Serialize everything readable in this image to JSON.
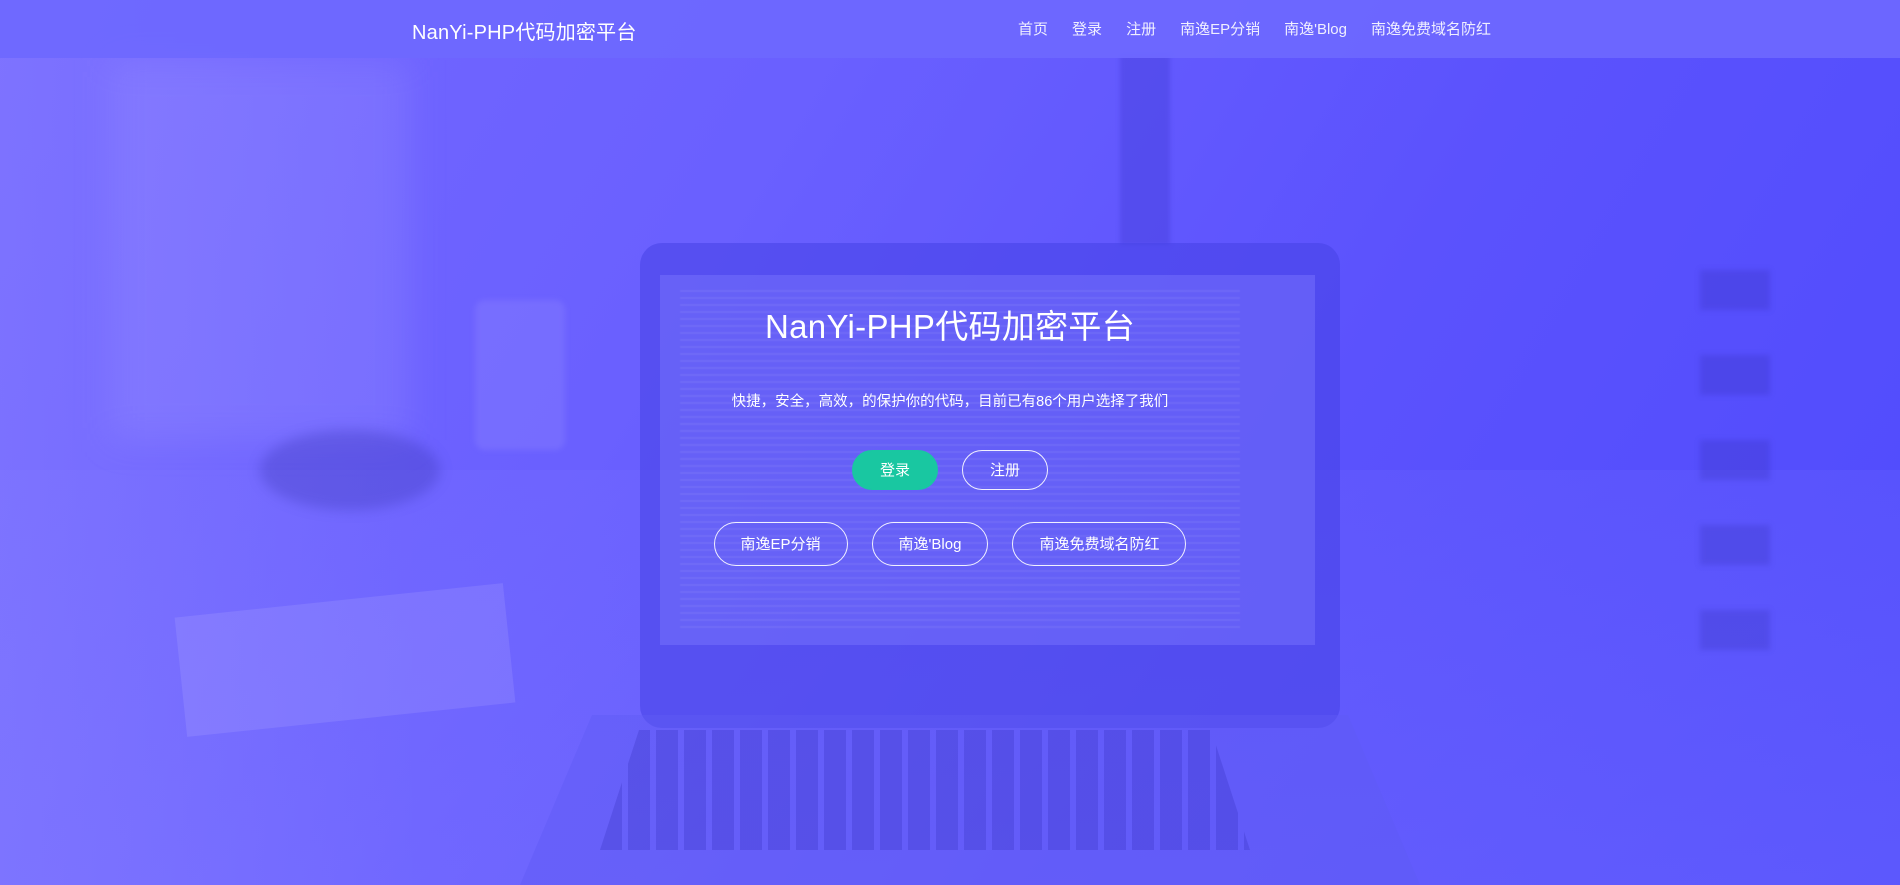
{
  "navbar": {
    "brand": "NanYi-PHP代码加密平台",
    "links": [
      "首页",
      "登录",
      "注册",
      "南逸EP分销",
      "南逸'Blog",
      "南逸免费域名防红"
    ]
  },
  "hero": {
    "title": "NanYi-PHP代码加密平台",
    "subtitle": "快捷，安全，高效，的保护你的代码，目前已有86个用户选择了我们",
    "primary_buttons": {
      "login": "登录",
      "register": "注册"
    },
    "link_buttons": [
      "南逸EP分销",
      "南逸'Blog",
      "南逸免费域名防红"
    ]
  },
  "colors": {
    "accent": "#19c7a1",
    "background": "#5b52fd"
  }
}
